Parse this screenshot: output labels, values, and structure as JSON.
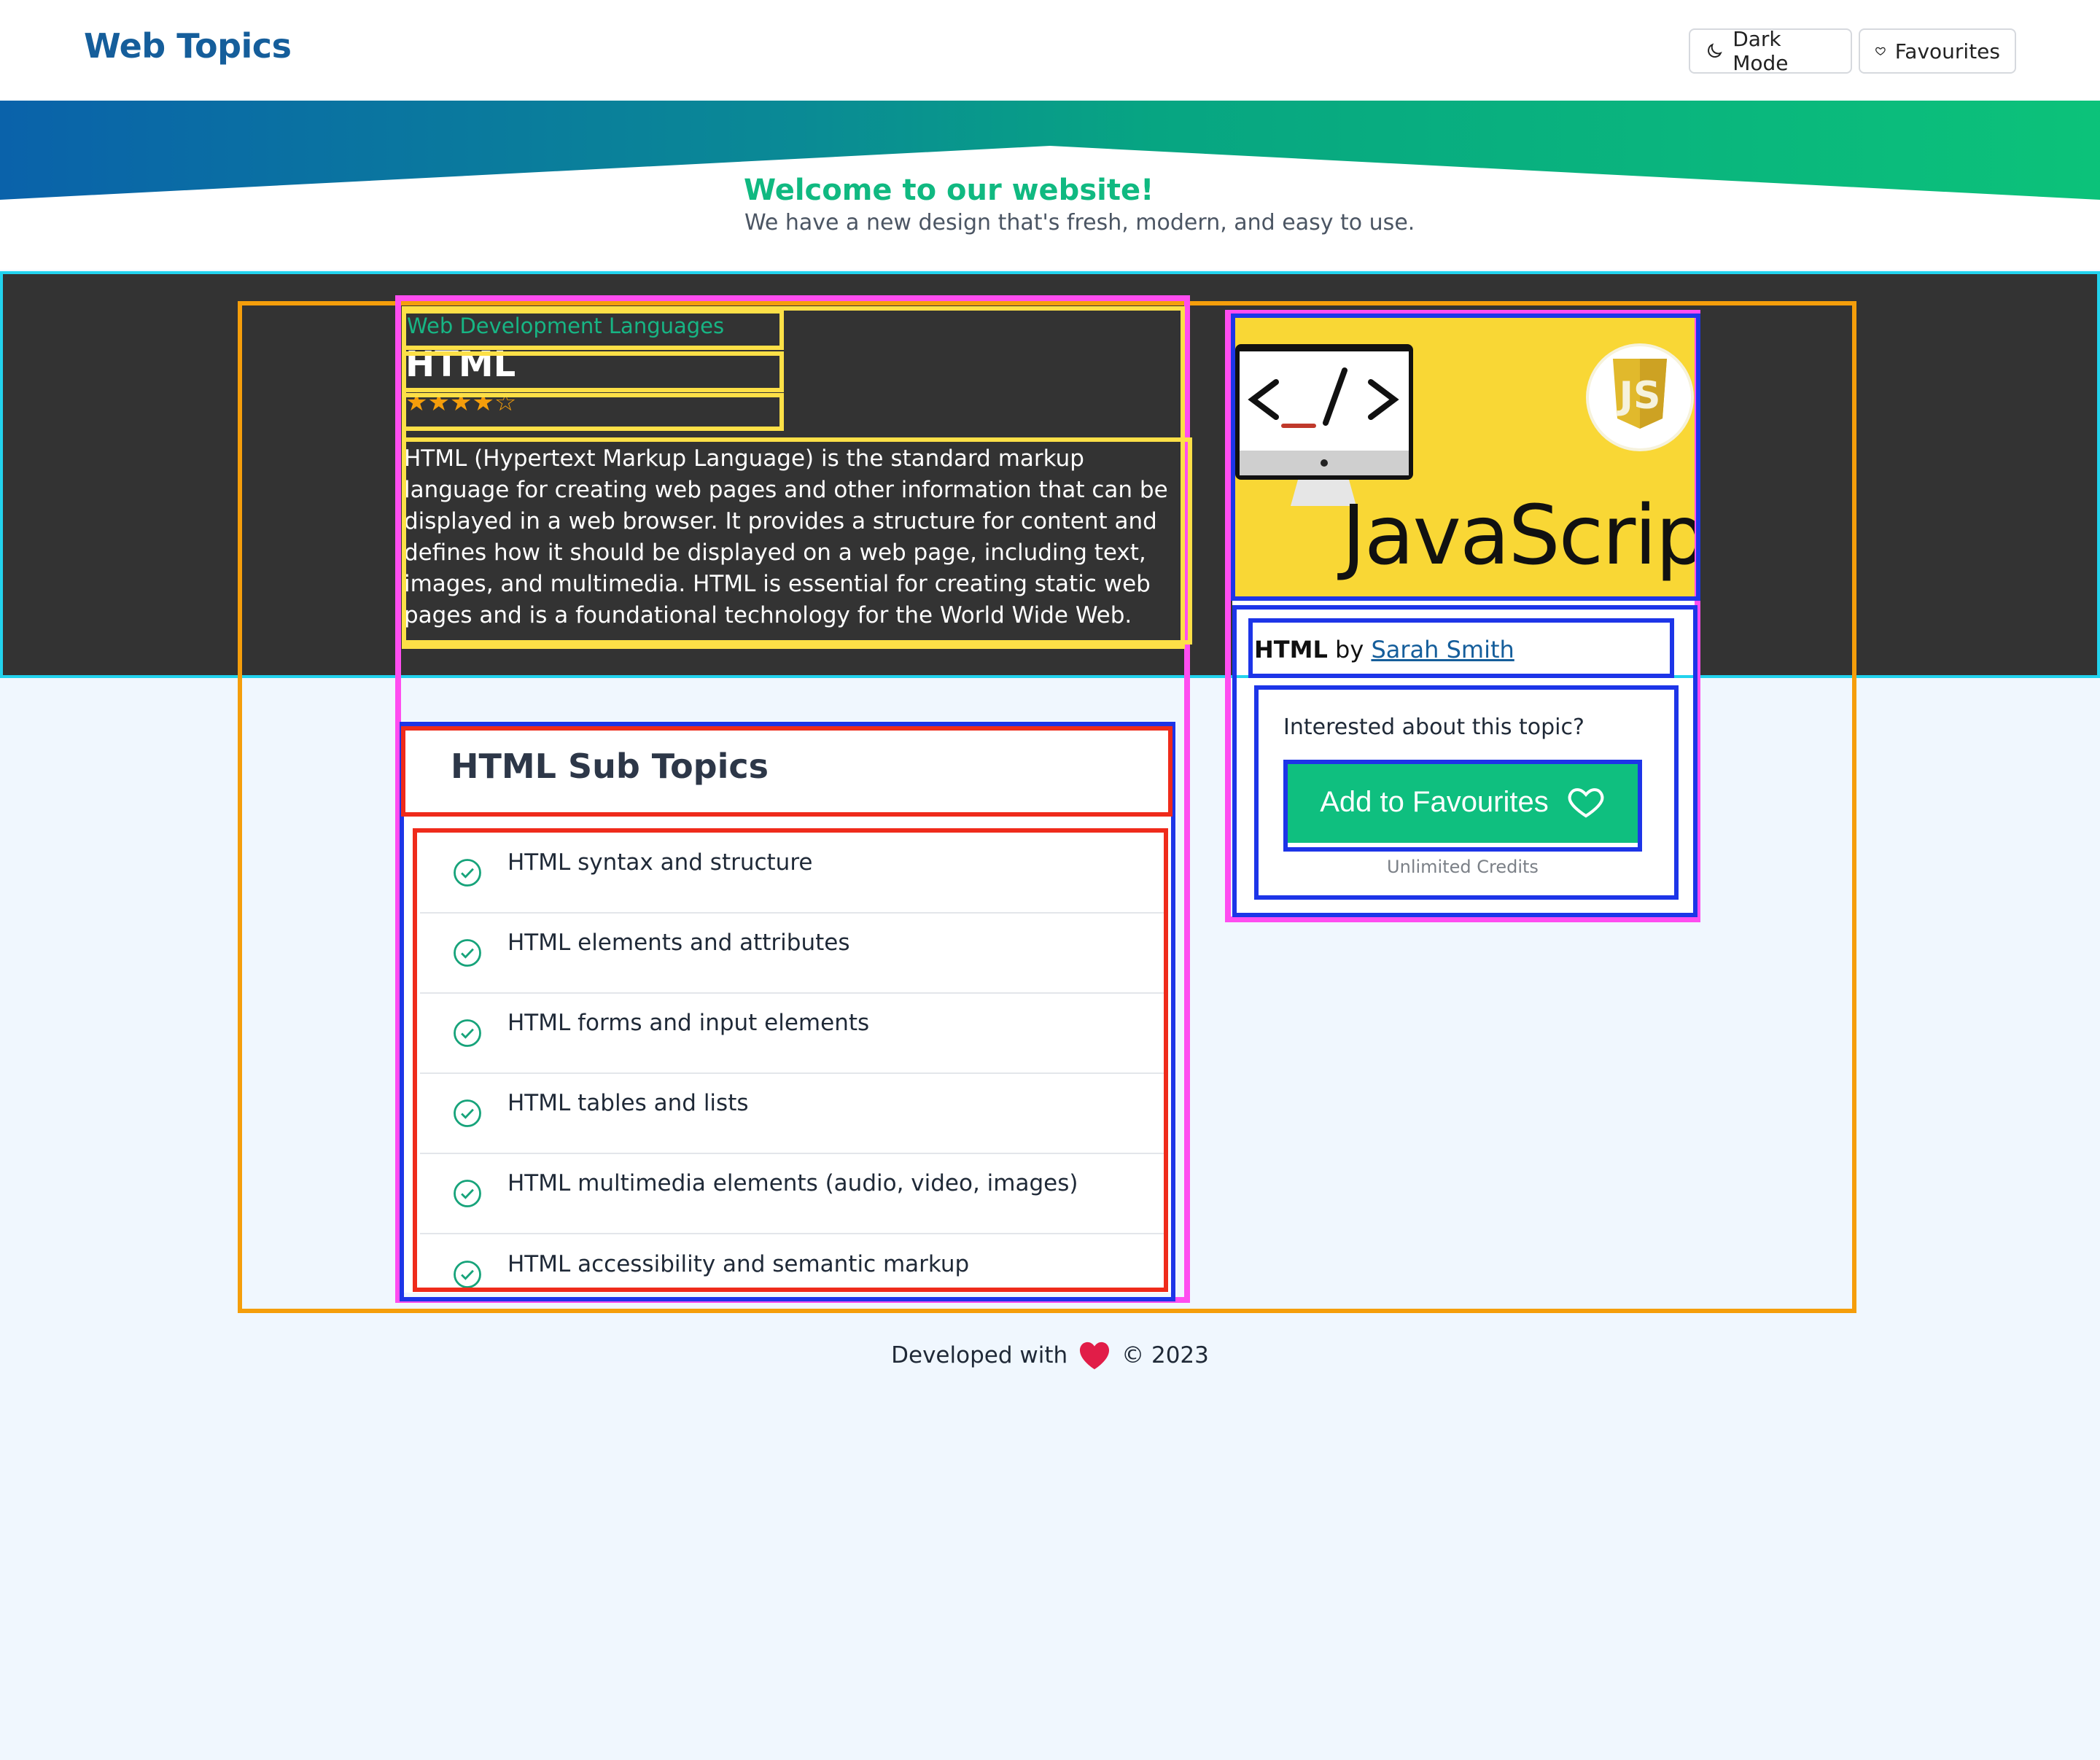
{
  "header": {
    "brand": "Web Topics",
    "dark_mode_label": "Dark Mode",
    "favourites_label": "Favourites"
  },
  "hero": {
    "title": "Welcome to our website!",
    "subtitle": "We have a new design that's fresh, modern, and easy to use."
  },
  "topic": {
    "category": "Web Development Languages",
    "title": "HTML",
    "rating": 4,
    "rating_max": 5,
    "stars": "★★★★☆",
    "description": "HTML (Hypertext Markup Language) is the standard markup language for creating web pages and other information that can be displayed in a web browser. It provides a structure for content and defines how it should be displayed on a web page, including text, images, and multimedia. HTML is essential for creating static web pages and is a foundational technology for the World Wide Web."
  },
  "side_card": {
    "image_icon": "javascript-logo-icon",
    "image_word": "JavaScript",
    "author_topic": "HTML",
    "author_by": "by",
    "author_name": "Sarah Smith",
    "question": "Interested about this topic?",
    "button_label": "Add to Favourites",
    "note": "Unlimited Credits"
  },
  "subtopics": {
    "title": "HTML Sub Topics",
    "items": [
      "HTML syntax and structure",
      "HTML elements and attributes",
      "HTML forms and input elements",
      "HTML tables and lists",
      "HTML multimedia elements (audio, video, images)",
      "HTML accessibility and semantic markup"
    ]
  },
  "footer": {
    "prefix": "Developed with",
    "suffix": "© 2023"
  },
  "colors": {
    "brand": "#155e9b",
    "accent_green": "#10b981",
    "button_green": "#0fbf7f",
    "dark_band": "#333333",
    "page_bg": "#f0f7fe",
    "js_yellow": "#f9d735",
    "heart_red": "#e11d48"
  }
}
